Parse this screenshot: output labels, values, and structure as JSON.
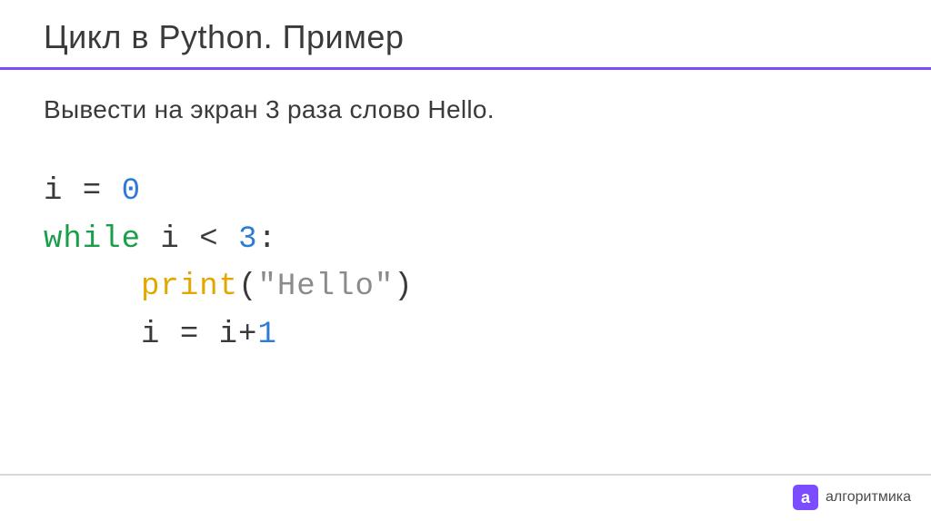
{
  "slide": {
    "title": "Цикл в Python. Пример",
    "task": "Вывести на экран 3 раза слово Hello."
  },
  "code": {
    "line1_var": "i = ",
    "line1_val": "0",
    "line2_kw": "while",
    "line2_cond": " i < ",
    "line2_num": "3",
    "line2_colon": ":",
    "line3_indent": "     ",
    "line3_func": "print",
    "line3_paren_open": "(",
    "line3_str": "\"Hello\"",
    "line3_paren_close": ")",
    "line4_indent": "     ",
    "line4_expr": "i = i+",
    "line4_num": "1"
  },
  "footer": {
    "logo_letter": "а",
    "brand": "алгоритмика"
  }
}
